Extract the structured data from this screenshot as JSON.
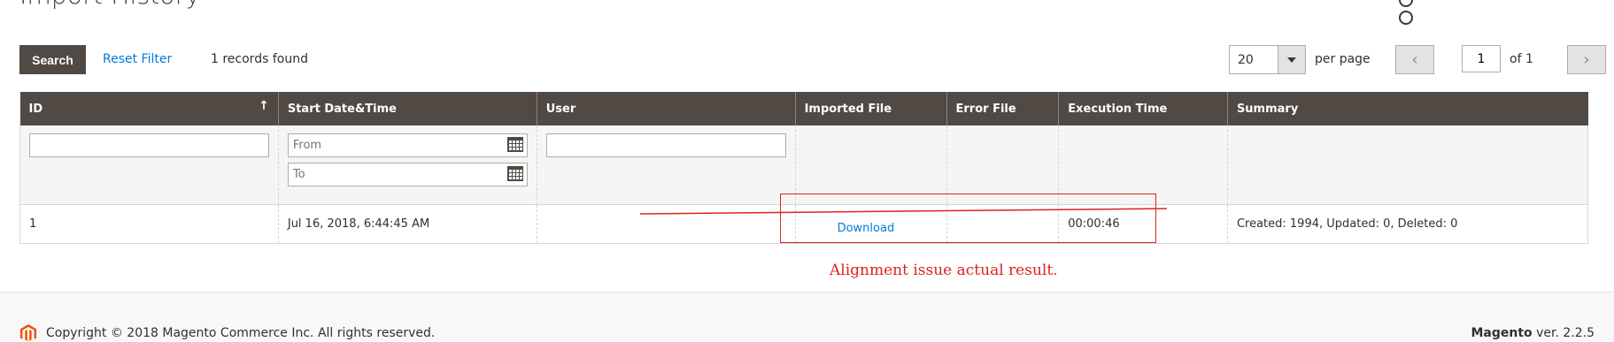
{
  "page": {
    "title": "Import History"
  },
  "toolbar": {
    "search_label": "Search",
    "reset_label": "Reset Filter",
    "records_found": "1 records found"
  },
  "pager": {
    "per_page_value": "20",
    "per_page_label": "per page",
    "prev_symbol": "‹",
    "next_symbol": "›",
    "current_page": "1",
    "of_label": "of 1"
  },
  "grid": {
    "columns": [
      "ID",
      "Start Date&Time",
      "User",
      "Imported File",
      "Error File",
      "Execution Time",
      "Summary"
    ],
    "sort_indicator": "↑",
    "filters": {
      "date_from_placeholder": "From",
      "date_to_placeholder": "To"
    },
    "rows": [
      {
        "id": "1",
        "start": "Jul 16, 2018, 6:44:45 AM",
        "user": "",
        "imported_file": "Download",
        "error_file": "",
        "execution_time": "00:00:46",
        "summary": "Created: 1994, Updated: 0, Deleted: 0"
      }
    ]
  },
  "annotation": {
    "text": "Alignment issue actual result.",
    "color": "#e02020"
  },
  "footer": {
    "copyright": "Copyright © 2018 Magento Commerce Inc. All rights reserved.",
    "brand": "Magento",
    "version": "ver. 2.2.5"
  },
  "colors": {
    "header_bg": "#514943",
    "link": "#007bdb",
    "logo": "#eb5202"
  }
}
